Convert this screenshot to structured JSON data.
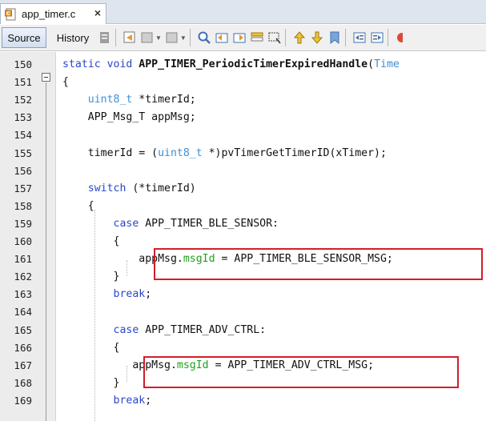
{
  "tab": {
    "label": "app_timer.c",
    "close": "×"
  },
  "toolbar": {
    "source_label": "Source",
    "history_label": "History"
  },
  "editor": {
    "lines": [
      {
        "num": "150",
        "parts": [
          [
            "kw",
            "static "
          ],
          [
            "kw",
            "void "
          ],
          [
            "fn",
            "APP_TIMER_PeriodicTimerExpiredHandle"
          ],
          [
            "",
            "("
          ],
          [
            "ty",
            "Time"
          ]
        ]
      },
      {
        "num": "151",
        "parts": [
          [
            "",
            "{"
          ]
        ]
      },
      {
        "num": "152",
        "parts": [
          [
            "",
            "    "
          ],
          [
            "ty",
            "uint8_t"
          ],
          [
            "",
            " *timerId;"
          ]
        ]
      },
      {
        "num": "153",
        "parts": [
          [
            "",
            "    APP_Msg_T appMsg;"
          ]
        ]
      },
      {
        "num": "154",
        "parts": [
          [
            "",
            ""
          ]
        ]
      },
      {
        "num": "155",
        "parts": [
          [
            "",
            "    timerId = ("
          ],
          [
            "ty",
            "uint8_t"
          ],
          [
            "",
            " *)pvTimerGetTimerID(xTimer);"
          ]
        ]
      },
      {
        "num": "156",
        "parts": [
          [
            "",
            ""
          ]
        ]
      },
      {
        "num": "157",
        "parts": [
          [
            "",
            "    "
          ],
          [
            "kw",
            "switch"
          ],
          [
            "",
            " (*timerId)"
          ]
        ]
      },
      {
        "num": "158",
        "parts": [
          [
            "",
            "    {"
          ]
        ]
      },
      {
        "num": "159",
        "parts": [
          [
            "",
            "        "
          ],
          [
            "kw",
            "case"
          ],
          [
            "",
            " APP_TIMER_BLE_SENSOR:"
          ]
        ]
      },
      {
        "num": "160",
        "parts": [
          [
            "",
            "        {"
          ]
        ]
      },
      {
        "num": "161",
        "parts": [
          [
            "",
            "            appMsg."
          ],
          [
            "fld",
            "msgId"
          ],
          [
            "",
            " = APP_TIMER_BLE_SENSOR_MSG;"
          ]
        ]
      },
      {
        "num": "162",
        "parts": [
          [
            "",
            "        }"
          ]
        ]
      },
      {
        "num": "163",
        "parts": [
          [
            "",
            "        "
          ],
          [
            "kw",
            "break"
          ],
          [
            "",
            ";"
          ]
        ]
      },
      {
        "num": "164",
        "parts": [
          [
            "",
            ""
          ]
        ]
      },
      {
        "num": "165",
        "parts": [
          [
            "",
            "        "
          ],
          [
            "kw",
            "case"
          ],
          [
            "",
            " APP_TIMER_ADV_CTRL:"
          ]
        ]
      },
      {
        "num": "166",
        "parts": [
          [
            "",
            "        {"
          ]
        ]
      },
      {
        "num": "167",
        "parts": [
          [
            "",
            "           appMsg."
          ],
          [
            "fld",
            "msgId"
          ],
          [
            "",
            " = APP_TIMER_ADV_CTRL_MSG;"
          ]
        ]
      },
      {
        "num": "168",
        "parts": [
          [
            "",
            "        }"
          ]
        ]
      },
      {
        "num": "169",
        "parts": [
          [
            "",
            "        "
          ],
          [
            "kw",
            "break"
          ],
          [
            "",
            ";"
          ]
        ]
      }
    ]
  }
}
